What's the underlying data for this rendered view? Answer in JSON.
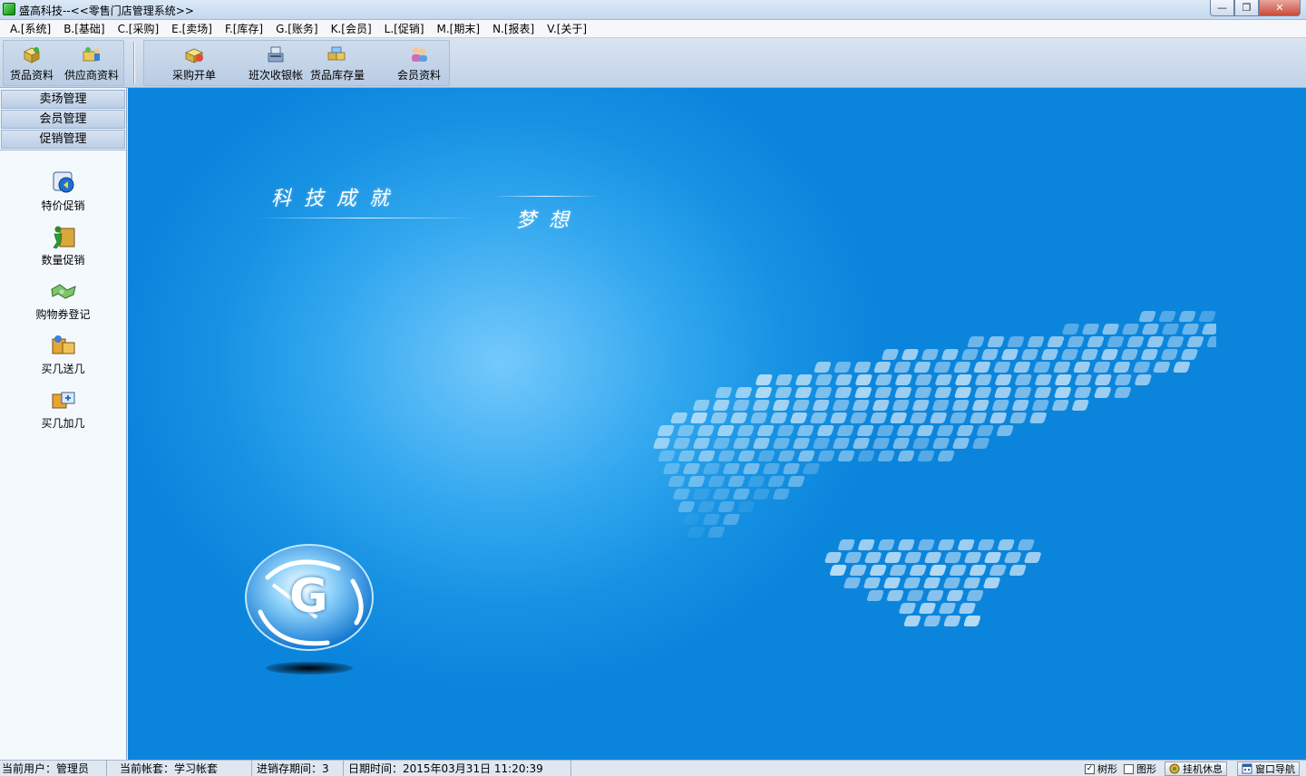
{
  "window": {
    "title": "盛高科技--<<零售门店管理系统>>",
    "controls": {
      "minimize": "—",
      "restore": "❐",
      "close": "✕"
    }
  },
  "menu": [
    {
      "label": "A.[系统]"
    },
    {
      "label": "B.[基础]"
    },
    {
      "label": "C.[采购]"
    },
    {
      "label": "E.[卖场]"
    },
    {
      "label": "F.[库存]"
    },
    {
      "label": "G.[账务]"
    },
    {
      "label": "K.[会员]"
    },
    {
      "label": "L.[促销]"
    },
    {
      "label": "M.[期末]"
    },
    {
      "label": "N.[报表]"
    },
    {
      "label": "V.[关于]"
    }
  ],
  "toolbar": {
    "group1": [
      {
        "label": "货品资料",
        "icon": "goods-box-icon"
      },
      {
        "label": "供应商资料",
        "icon": "supplier-icon"
      }
    ],
    "group2": [
      {
        "label": "采购开单",
        "icon": "purchase-order-icon"
      },
      {
        "label": "班次收银帐",
        "icon": "cashier-icon"
      },
      {
        "label": "货品库存量",
        "icon": "inventory-icon"
      },
      {
        "label": "会员资料",
        "icon": "member-icon"
      }
    ]
  },
  "sidebar": {
    "headers": [
      "卖场管理",
      "会员管理",
      "促销管理"
    ],
    "items": [
      {
        "label": "特价促销",
        "icon": "special-price-icon"
      },
      {
        "label": "数量促销",
        "icon": "quantity-promo-icon"
      },
      {
        "label": "购物券登记",
        "icon": "coupon-icon"
      },
      {
        "label": "买几送几",
        "icon": "buy-get-free-icon"
      },
      {
        "label": "买几加几",
        "icon": "buy-add-icon"
      }
    ]
  },
  "main": {
    "slogan_top": "科  技  成  就",
    "slogan_bottom": "梦  想",
    "logo_letter": "G",
    "colors": {
      "bg_dark": "#0b85dc",
      "bg_light": "#74c9fb"
    }
  },
  "statusbar": {
    "user": "当前用户：管理员",
    "account": "当前帐套：学习帐套",
    "period": "进销存期间：3",
    "datetime": "日期时间：2015年03月31日 11:20:39",
    "tree_label": "树形",
    "graph_label": "图形",
    "hangup_label": "挂机休息",
    "nav_label": "窗口导航"
  }
}
